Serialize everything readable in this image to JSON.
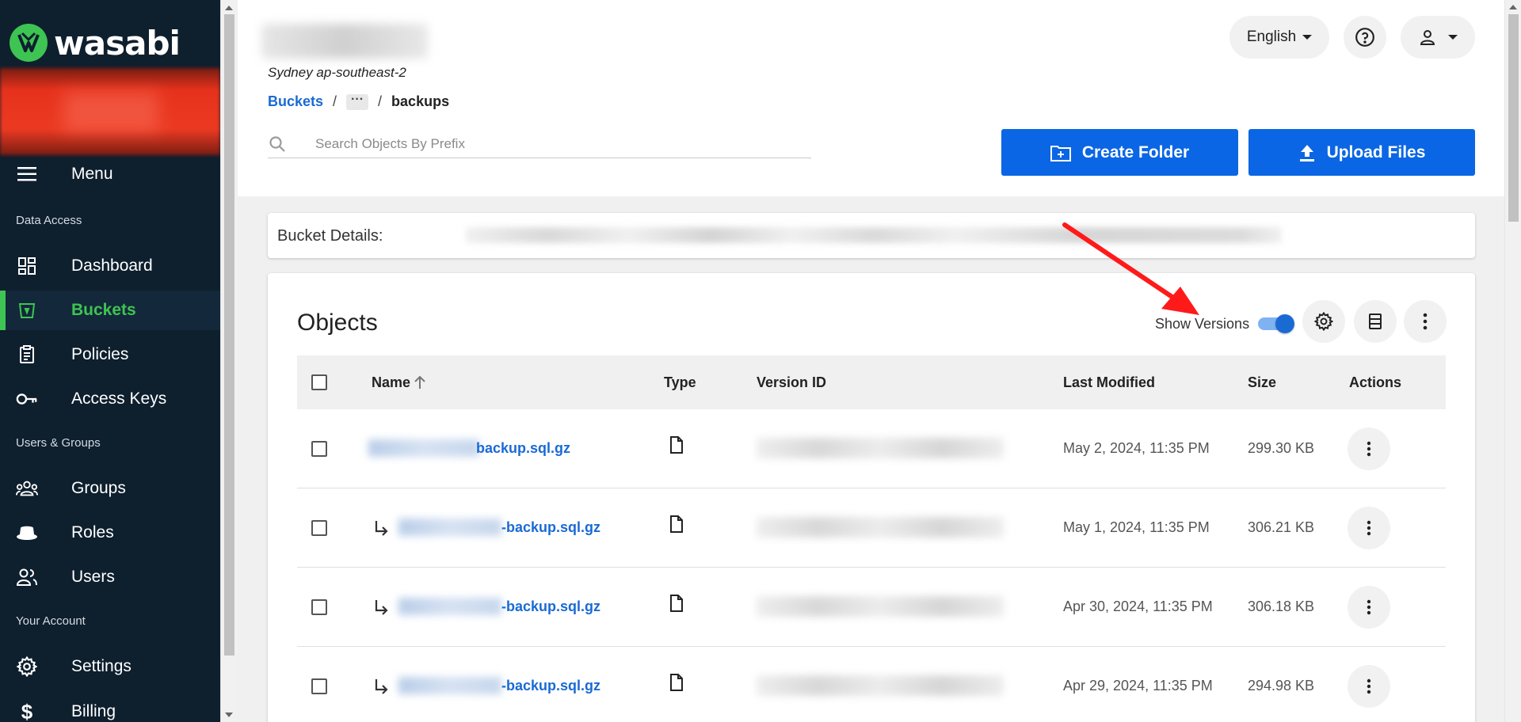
{
  "sidebar": {
    "brand": "wasabi",
    "menu_label": "Menu",
    "sections": {
      "data_access": "Data Access",
      "users_groups": "Users & Groups",
      "your_account": "Your Account"
    },
    "items": [
      {
        "label": "Dashboard",
        "icon": "dashboard-icon"
      },
      {
        "label": "Buckets",
        "icon": "bucket-icon",
        "active": true
      },
      {
        "label": "Policies",
        "icon": "policy-icon"
      },
      {
        "label": "Access Keys",
        "icon": "key-icon"
      },
      {
        "label": "Groups",
        "icon": "groups-icon"
      },
      {
        "label": "Roles",
        "icon": "roles-icon"
      },
      {
        "label": "Users",
        "icon": "users-icon"
      },
      {
        "label": "Settings",
        "icon": "gear-icon"
      },
      {
        "label": "Billing",
        "icon": "dollar-icon"
      }
    ],
    "accent_color": "#3ec452"
  },
  "header": {
    "region": "Sydney ap-southeast-2",
    "breadcrumb": {
      "root": "Buckets",
      "ellipsis": "···",
      "current": "backups"
    },
    "search_placeholder": "Search Objects By Prefix",
    "language": "English",
    "create_folder": "Create Folder",
    "upload_files": "Upload Files",
    "primary_color": "#0a66e4"
  },
  "details": {
    "label": "Bucket Details:"
  },
  "objects": {
    "title": "Objects",
    "show_versions_label": "Show Versions",
    "show_versions_on": true,
    "columns": {
      "name": "Name",
      "type": "Type",
      "version_id": "Version ID",
      "last_modified": "Last Modified",
      "size": "Size",
      "actions": "Actions"
    },
    "rows": [
      {
        "name_visible": "backup.sql.gz",
        "last_modified": "May 2, 2024, 11:35 PM",
        "size": "299.30 KB",
        "is_version": false
      },
      {
        "name_visible": "-backup.sql.gz",
        "last_modified": "May 1, 2024, 11:35 PM",
        "size": "306.21 KB",
        "is_version": true
      },
      {
        "name_visible": "-backup.sql.gz",
        "last_modified": "Apr 30, 2024, 11:35 PM",
        "size": "306.18 KB",
        "is_version": true
      },
      {
        "name_visible": "-backup.sql.gz",
        "last_modified": "Apr 29, 2024, 11:35 PM",
        "size": "294.98 KB",
        "is_version": true
      }
    ]
  }
}
